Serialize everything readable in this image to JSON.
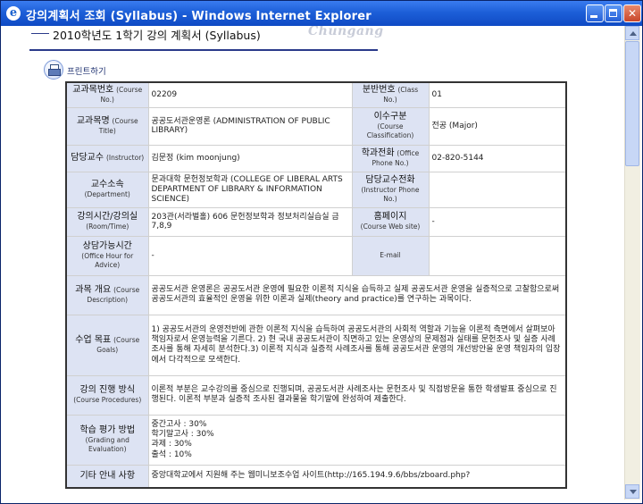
{
  "window": {
    "title": "강의계획서 조회 (Syllabus) - Windows Internet Explorer",
    "minimize_label": "",
    "maximize_label": "",
    "close_label": "✕"
  },
  "page": {
    "title": "2010학년도 1학기 강의 계획서 (Syllabus)",
    "logo_text": "Chungang",
    "print_label": "프린트하기"
  },
  "rows": [
    {
      "l1_ko": "교과목번호",
      "l1_en": "(Course No.)",
      "v1": "02209",
      "l2_ko": "분반번호",
      "l2_en": "(Class No.)",
      "v2": "01"
    },
    {
      "l1_ko": "교과목명",
      "l1_en": "(Course Title)",
      "v1": "공공도서관운영론 (ADMINISTRATION OF PUBLIC LIBRARY)",
      "l2_ko": "이수구분",
      "l2_en": "(Course Classification)",
      "v2": "전공 (Major)"
    },
    {
      "l1_ko": "담당교수",
      "l1_en": "(Instructor)",
      "v1": "김문정 (kim moonjung)",
      "l2_ko": "학과전화",
      "l2_en": "(Office Phone No.)",
      "v2": "02-820-5144"
    },
    {
      "l1_ko": "교수소속",
      "l1_en": "(Department)",
      "v1": "문과대학 문헌정보학과 (COLLEGE OF LIBERAL ARTS DEPARTMENT OF LIBRARY & INFORMATION SCIENCE)",
      "l2_ko": "담당교수전화",
      "l2_en": "(Instructor Phone No.)",
      "v2": ""
    },
    {
      "l1_ko": "강의시간/강의실",
      "l1_en": "(Room/Time)",
      "v1": "203관(서라벌홀) 606 문헌정보학과 정보처리실습실 금7,8,9",
      "l2_ko": "홈페이지",
      "l2_en": "(Course Web site)",
      "v2": "-"
    },
    {
      "l1_ko": "상담가능시간",
      "l1_en": "(Office Hour for Advice)",
      "v1": "-",
      "l2_ko": "",
      "l2_en": "E-mail",
      "v2": ""
    }
  ],
  "full_rows": [
    {
      "l_ko": "과목 개요",
      "l_en": "(Course Description)",
      "v": "공공도서관 운영론은 공공도서관 운영에 필요한 이론적 지식을 습득하고 실제 공공도서관 운영을 실증적으로 고찰함으로써 공공도서관의 효율적인 운영을 위한 이론과 실제(theory and practice)를 연구하는 과목이다."
    },
    {
      "l_ko": "수업 목표",
      "l_en": "(Course Goals)",
      "v": "1) 공공도서관의 운영전반에 관한 이론적 지식을 습득하여 공공도서관의 사회적 역할과 기능을 이론적 측면에서 살펴보아 책임자로서 운영능력을 기른다. 2) 현 국내 공공도서관이 직면하고 있는 운영상의 문제점과 실태를 문헌조사 및 실증 사례조사를 통해 자세히 분석한다.3) 이론적 지식과 실증적 사례조사를 통해 공공도서관 운영의 개선방안을 운영 책임자의 입장에서 다각적으로 모색한다."
    },
    {
      "l_ko": "강의 진행 방식",
      "l_en": "(Course Procedures)",
      "v": "이론적 부분은 교수강의를 중심으로 진행되며, 공공도서관 사례조사는 문헌조사 및 직접방문을 통한 학생발표 중심으로 진행된다. 이론적 부분과 실증적 조사된 결과물을 학기말에 완성하여 제출한다."
    },
    {
      "l_ko": "학습 평가 방법",
      "l_en": "(Grading and Evaluation)",
      "v": "중간고사 : 30%\n학기말고사 : 30%\n과제 : 30%\n출석 : 10%"
    },
    {
      "l_ko": "기타 안내 사항",
      "l_en": "",
      "v": "중앙대학교에서 지원해 주는 웹미니보조수업 사이트(http://165.194.9.6/bbs/zboard.php?"
    }
  ]
}
